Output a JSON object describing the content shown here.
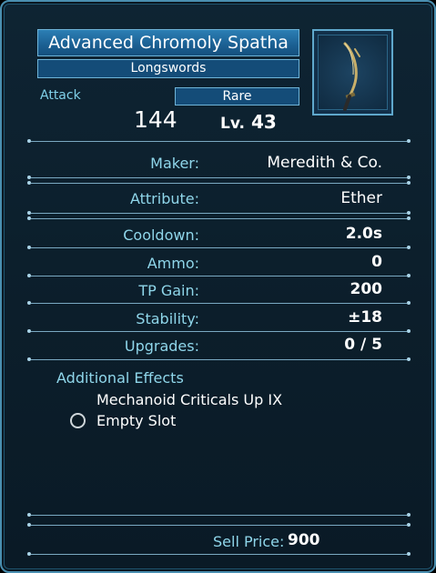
{
  "item": {
    "name": "Advanced Chromoly Spatha",
    "category": "Longswords",
    "attack_label": "Attack",
    "attack_value": "144",
    "rarity": "Rare",
    "level_prefix": "Lv.",
    "level_value": "43"
  },
  "stats": {
    "maker_label": "Maker:",
    "maker_value": "Meredith & Co.",
    "attribute_label": "Attribute:",
    "attribute_value": "Ether",
    "cooldown_label": "Cooldown:",
    "cooldown_value": "2.0s",
    "ammo_label": "Ammo:",
    "ammo_value": "0",
    "tp_label": "TP Gain:",
    "tp_value": "200",
    "stability_label": "Stability:",
    "stability_value": "±18",
    "upgrades_label": "Upgrades:",
    "upgrades_value": "0 / 5"
  },
  "effects": {
    "title": "Additional Effects",
    "items": [
      "Mechanoid Criticals Up IX",
      "Empty Slot"
    ]
  },
  "sell": {
    "label": "Sell Price:",
    "value": "900"
  },
  "icons": {
    "weapon": "longsword-icon",
    "slot": "empty-slot-icon"
  },
  "colors": {
    "accent": "#2c7fb4",
    "label": "#8fd6ea",
    "border": "#4a8fb0"
  }
}
